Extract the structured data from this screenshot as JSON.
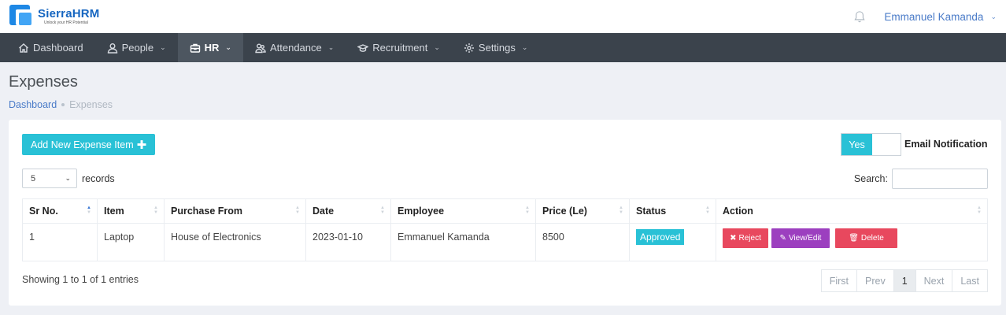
{
  "brand": {
    "name": "SierraHRM",
    "tagline": "Unlock your HR Potential"
  },
  "header": {
    "user_name": "Emmanuel Kamanda"
  },
  "nav": {
    "items": [
      {
        "label": "Dashboard",
        "icon": "home-icon",
        "has_dropdown": false
      },
      {
        "label": "People",
        "icon": "person-icon",
        "has_dropdown": true
      },
      {
        "label": "HR",
        "icon": "briefcase-icon",
        "has_dropdown": true,
        "active": true
      },
      {
        "label": "Attendance",
        "icon": "people-icon",
        "has_dropdown": true
      },
      {
        "label": "Recruitment",
        "icon": "graduation-cap-icon",
        "has_dropdown": true
      },
      {
        "label": "Settings",
        "icon": "gear-icon",
        "has_dropdown": true
      }
    ]
  },
  "page": {
    "title": "Expenses",
    "breadcrumb": {
      "home": "Dashboard",
      "current": "Expenses"
    }
  },
  "toolbar": {
    "add_label": "Add New Expense Item",
    "toggle_label": "Yes",
    "email_label": "Email Notification"
  },
  "table_controls": {
    "page_size": "5",
    "records_label": "records",
    "search_label": "Search:",
    "search_value": ""
  },
  "table": {
    "columns": [
      "Sr No.",
      "Item",
      "Purchase From",
      "Date",
      "Employee",
      "Price (Le)",
      "Status",
      "Action"
    ],
    "rows": [
      {
        "sr": "1",
        "item": "Laptop",
        "purchase_from": "House of Electronics",
        "date": "2023-01-10",
        "employee": "Emmanuel Kamanda",
        "price": "8500",
        "status": "Approved"
      }
    ],
    "actions": {
      "reject": "Reject",
      "edit": "View/Edit",
      "delete": "Delete"
    }
  },
  "footer": {
    "showing": "Showing 1 to 1 of 1 entries",
    "pager": {
      "first": "First",
      "prev": "Prev",
      "current": "1",
      "next": "Next",
      "last": "Last"
    }
  },
  "colors": {
    "accent": "#29c1d6",
    "danger": "#e8485e",
    "purple": "#9c3fbf",
    "nav_bg": "#3b434c",
    "link": "#4a7bc8"
  }
}
